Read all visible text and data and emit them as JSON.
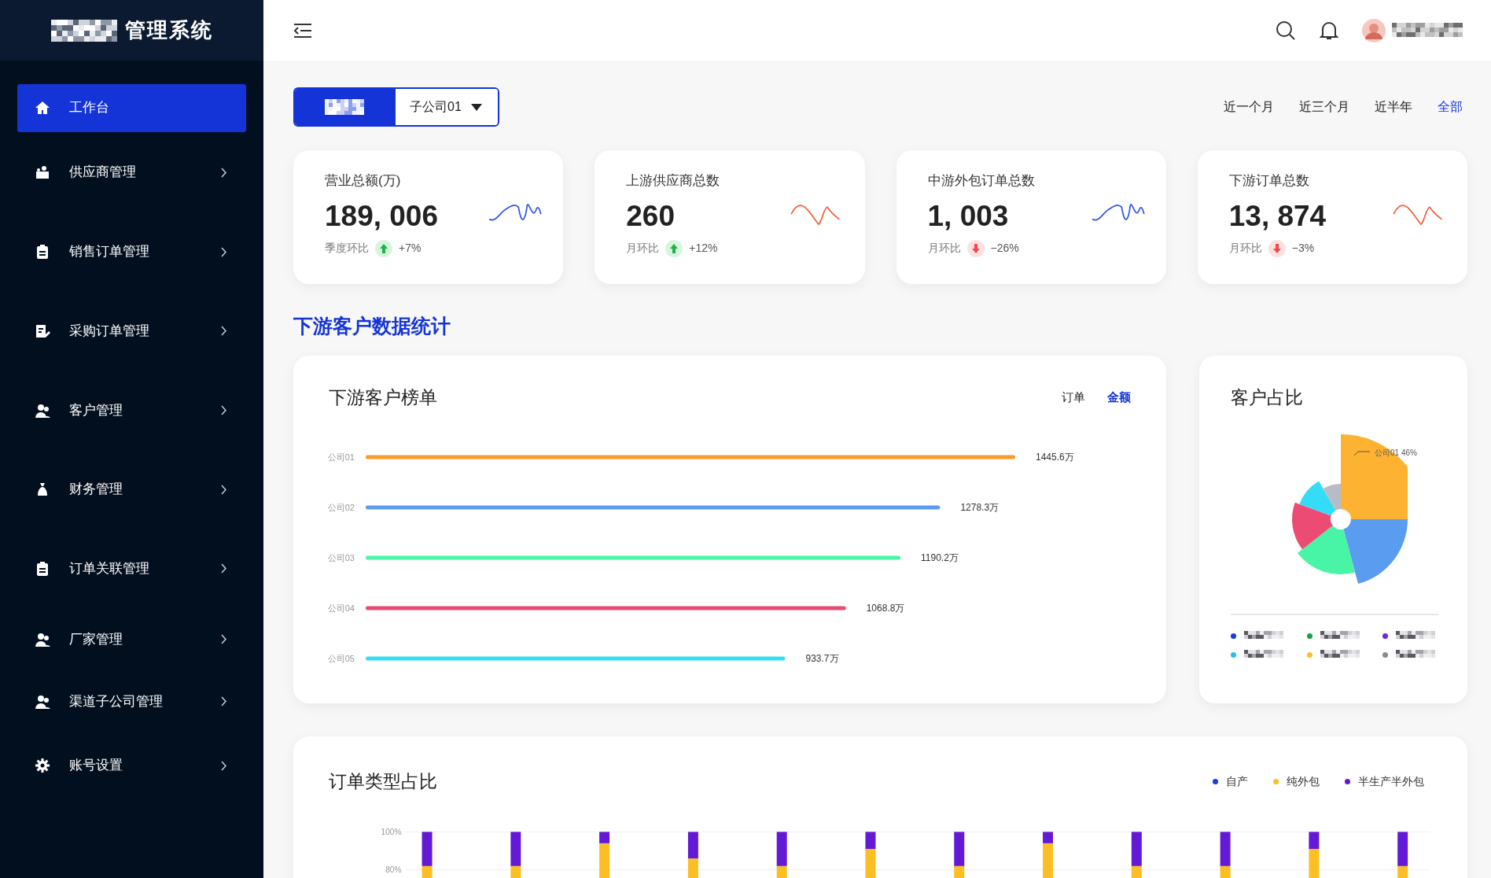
{
  "app": {
    "title": "管理系统"
  },
  "sidebar": {
    "items": [
      {
        "label": "工作台",
        "selected": true,
        "expandable": false
      },
      {
        "label": "供应商管理",
        "selected": false,
        "expandable": true
      },
      {
        "label": "销售订单管理",
        "selected": false,
        "expandable": true
      },
      {
        "label": "采购订单管理",
        "selected": false,
        "expandable": true
      },
      {
        "label": "客户管理",
        "selected": false,
        "expandable": true
      },
      {
        "label": "财务管理",
        "selected": false,
        "expandable": true
      },
      {
        "label": "订单关联管理",
        "selected": false,
        "expandable": true
      },
      {
        "label": "厂家管理",
        "selected": false,
        "expandable": true
      },
      {
        "label": "渠道子公司管理",
        "selected": false,
        "expandable": true
      },
      {
        "label": "账号设置",
        "selected": false,
        "expandable": true
      }
    ]
  },
  "filter": {
    "scope_toggle": {
      "selected": true
    },
    "company": {
      "value": "子公司01"
    },
    "ranges": [
      {
        "label": "近一个月",
        "selected": false
      },
      {
        "label": "近三个月",
        "selected": false
      },
      {
        "label": "近半年",
        "selected": false
      },
      {
        "label": "全部",
        "selected": true
      }
    ]
  },
  "stats": [
    {
      "title": "营业总额(万)",
      "value": "189, 006",
      "compare_label": "季度环比",
      "rising": true,
      "change": "+7%",
      "color": "#2f54eb"
    },
    {
      "title": "上游供应商总数",
      "value": "260",
      "compare_label": "月环比",
      "rising": true,
      "change": "+12%",
      "color": "#f5603c"
    },
    {
      "title": "中游外包订单总数",
      "value": "1, 003",
      "compare_label": "月环比",
      "rising": false,
      "change": "−26%",
      "color": "#2f54eb"
    },
    {
      "title": "下游订单总数",
      "value": "13, 874",
      "compare_label": "月环比",
      "rising": false,
      "change": "−3%",
      "color": "#f5603c"
    }
  ],
  "section_title": "下游客户数据统计",
  "ranking": {
    "title": "下游客户榜单",
    "toggles": [
      {
        "label": "订单",
        "selected": false
      },
      {
        "label": "金额",
        "selected": true
      }
    ],
    "chart_data": {
      "type": "bar",
      "orientation": "horizontal",
      "categories": [
        "公司01",
        "公司02",
        "公司03",
        "公司04",
        "公司05"
      ],
      "values": [
        1445.6,
        1278.3,
        1190.2,
        1068.8,
        933.7
      ],
      "colors": [
        "#fa9a2b",
        "#5b9bf0",
        "#48f5a6",
        "#e84b74",
        "#35dcf8"
      ],
      "value_labels": [
        "1445.6万",
        "1278.3万",
        "1190.2万",
        "1068.8万",
        "933.7万"
      ]
    }
  },
  "share": {
    "title": "客户占比",
    "slice_label": "公司01 46%",
    "legend": [
      {
        "color": "#1a3ce0"
      },
      {
        "color": "#16a34a"
      },
      {
        "color": "#6d28d9"
      },
      {
        "color": "#22c1f5"
      },
      {
        "color": "#fbbf24"
      },
      {
        "color": "#8a8a8a"
      }
    ]
  },
  "order_types": {
    "title": "订单类型占比",
    "chart_data": {
      "type": "bar",
      "stacked": true,
      "ylim": [
        0,
        100
      ],
      "yticks": [
        {
          "value": 100,
          "label": "100%"
        },
        {
          "value": 80,
          "label": "80%"
        }
      ],
      "series": [
        {
          "name": "自产",
          "color": "#1a3ce0",
          "values": [
            null,
            null,
            null,
            null,
            null,
            null,
            null,
            null,
            null,
            null,
            null,
            null
          ]
        },
        {
          "name": "纯外包",
          "color": "#fbbf24",
          "values": [
            82,
            82,
            94,
            86,
            82,
            91,
            82,
            94,
            82,
            82,
            91,
            82
          ]
        },
        {
          "name": "半生产半外包",
          "color": "#6419d6",
          "values": [
            18,
            18,
            6,
            14,
            18,
            9,
            18,
            6,
            18,
            18,
            9,
            18
          ]
        }
      ]
    }
  }
}
